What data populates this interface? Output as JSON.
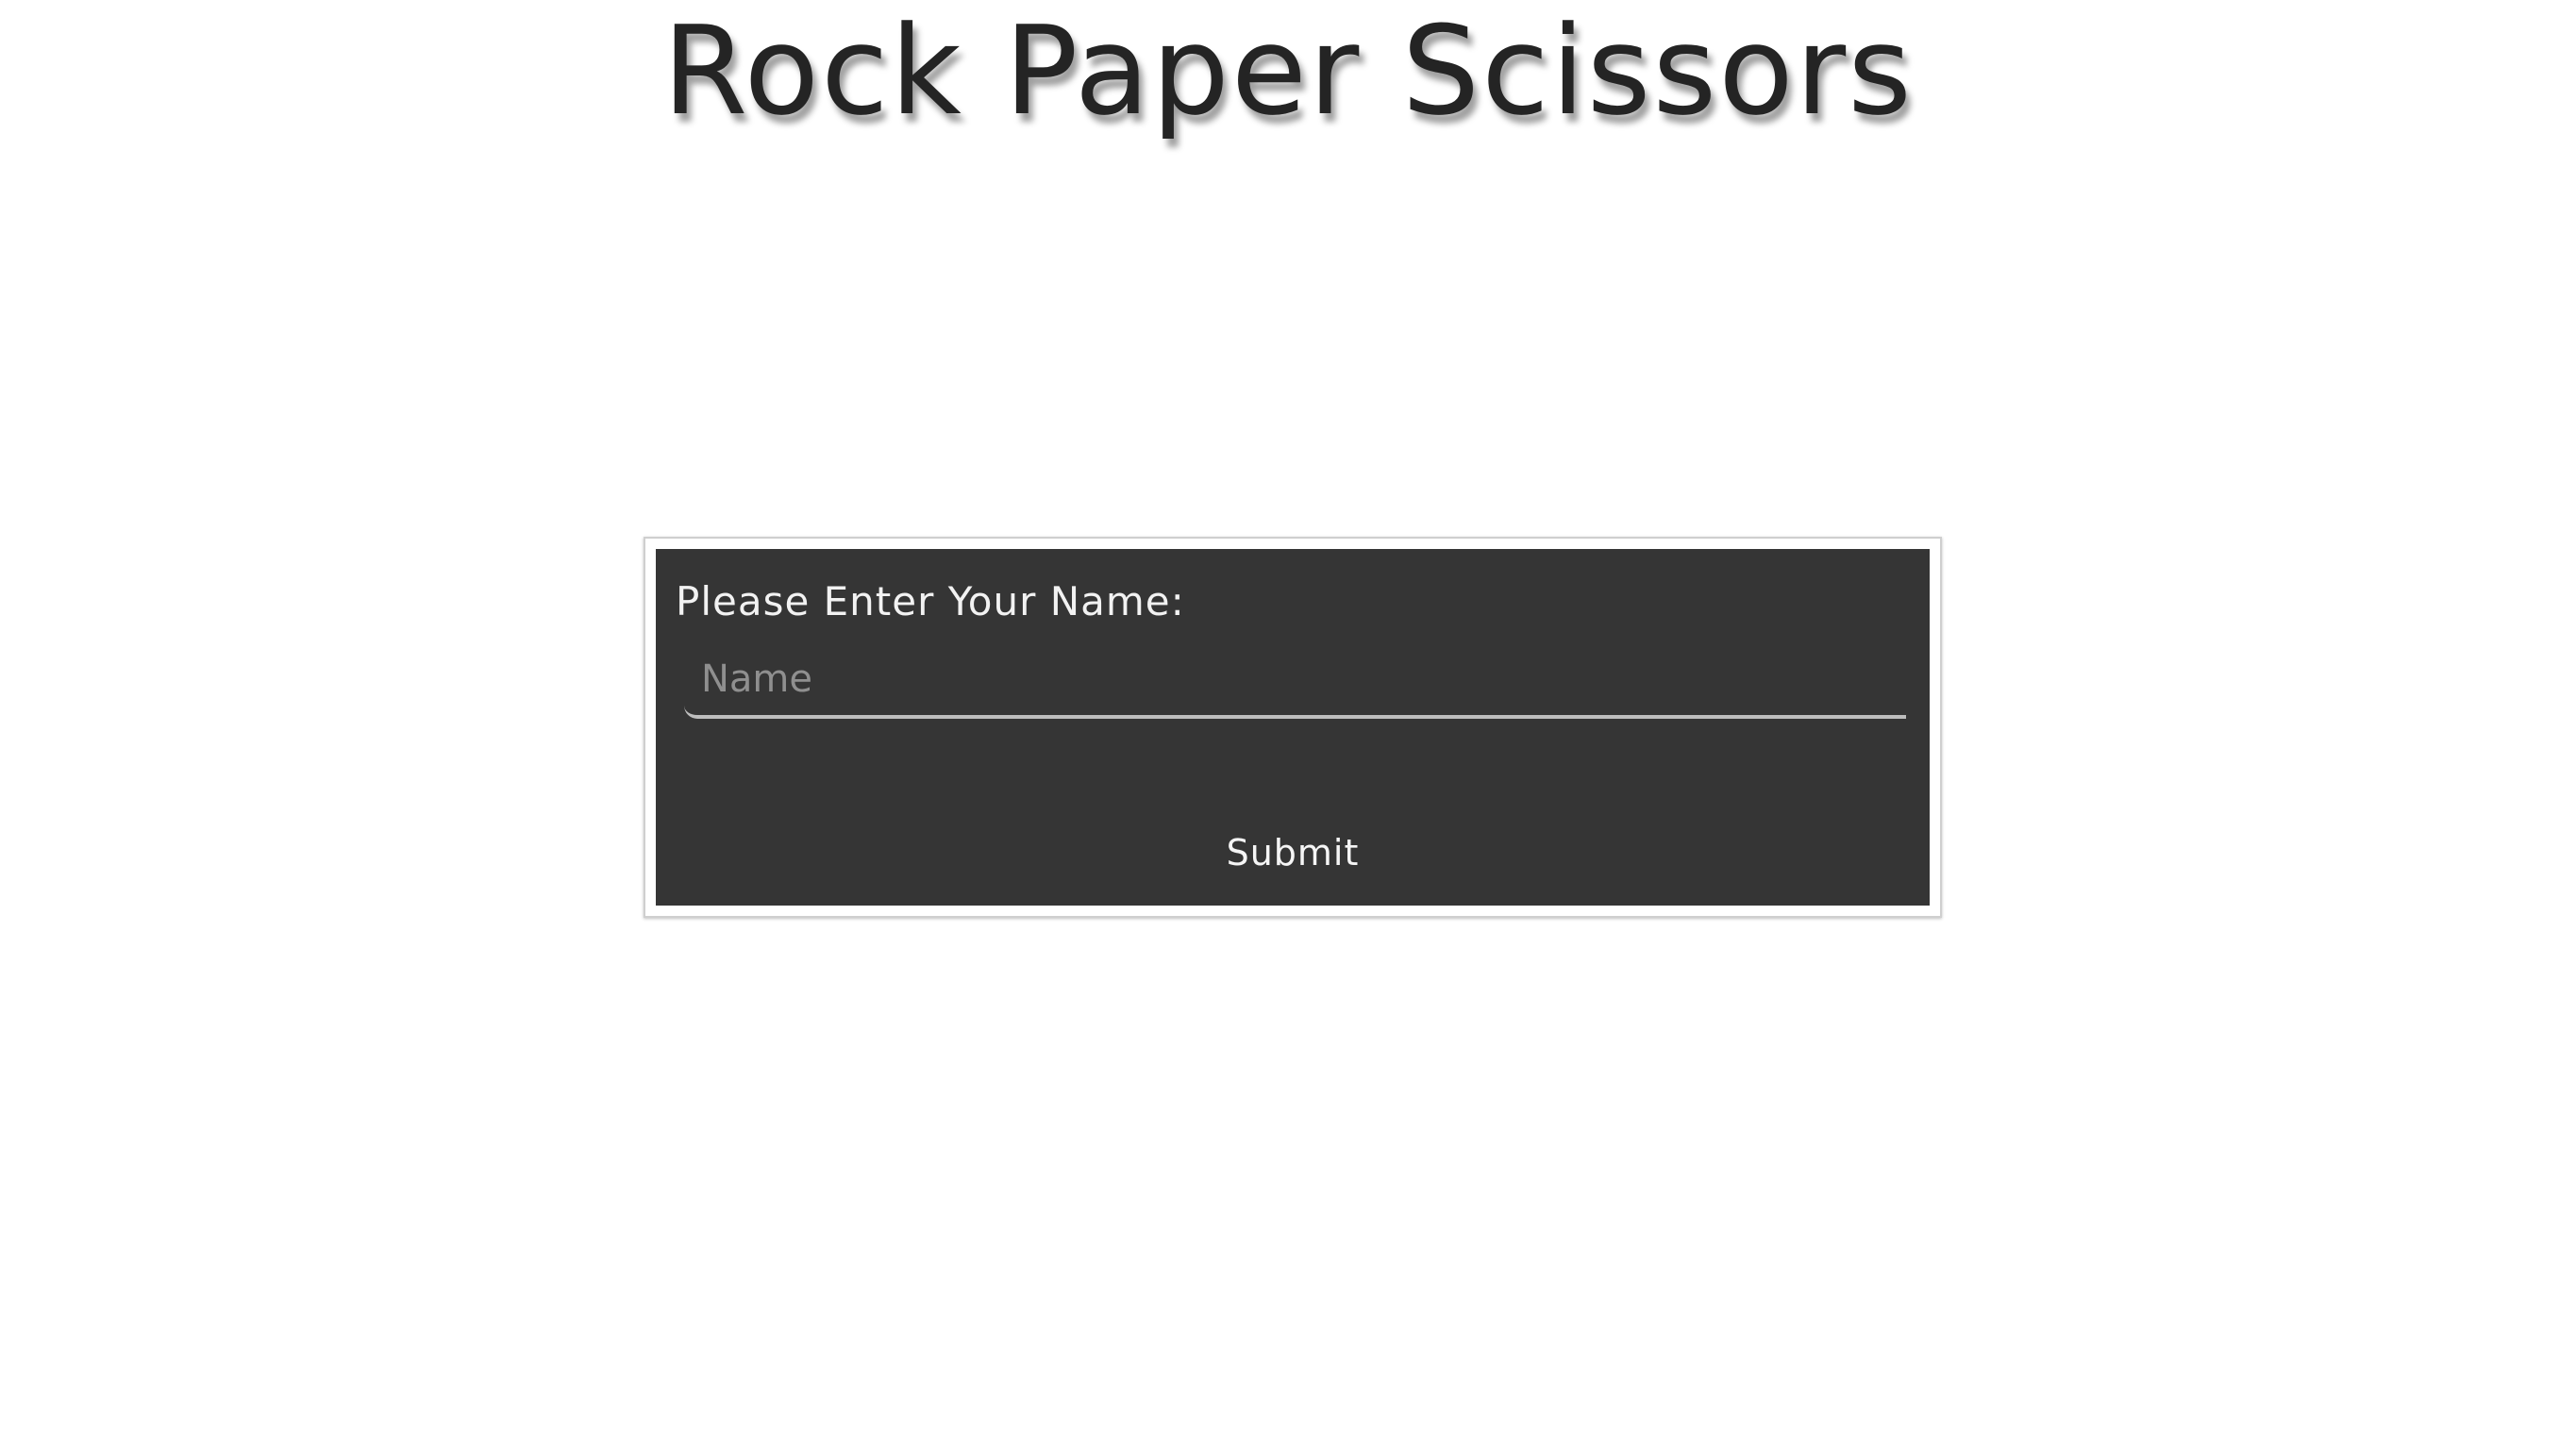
{
  "page": {
    "title": "Rock Paper Scissors"
  },
  "form": {
    "prompt": "Please Enter Your Name:",
    "name_placeholder": "Name",
    "name_value": "",
    "submit_label": "Submit"
  },
  "colors": {
    "background": "#ffffff",
    "title_text": "#242424",
    "card_background": "#353535",
    "card_text": "#f2f2f2",
    "placeholder_text": "#8f8f8f",
    "input_underline": "#bdbdbd"
  }
}
